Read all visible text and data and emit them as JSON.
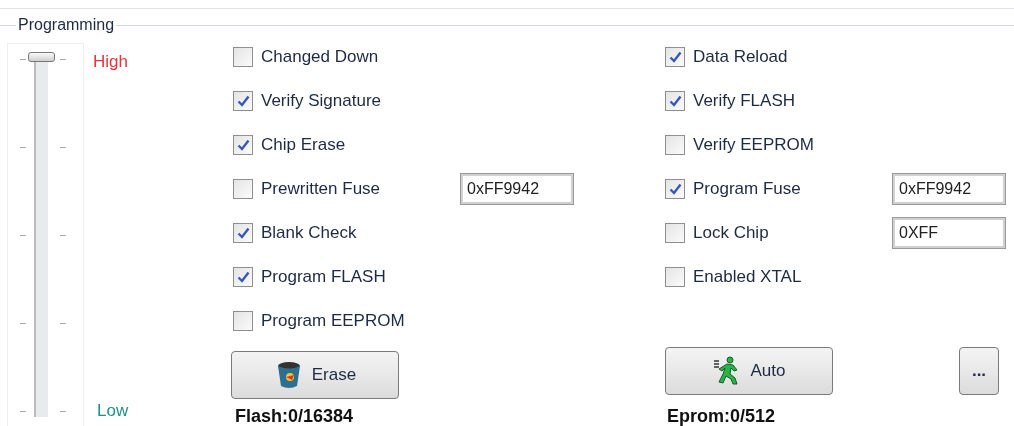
{
  "group": {
    "title": "Programming"
  },
  "slider": {
    "level": 1,
    "high_label": "High",
    "low_label": "Low"
  },
  "left_column": {
    "options": [
      {
        "label": "Changed Down",
        "checked": false
      },
      {
        "label": "Verify Signature",
        "checked": true
      },
      {
        "label": "Chip Erase",
        "checked": true
      },
      {
        "label": "Prewritten Fuse",
        "checked": false,
        "value": "0xFF9942"
      },
      {
        "label": "Blank Check",
        "checked": true
      },
      {
        "label": "Program FLASH",
        "checked": true
      },
      {
        "label": "Program EEPROM",
        "checked": false
      }
    ],
    "button": {
      "kind": "erase",
      "label": "Erase"
    },
    "counter": "Flash:0/16384"
  },
  "right_column": {
    "options": [
      {
        "label": "Data Reload",
        "checked": true
      },
      {
        "label": "Verify FLASH",
        "checked": true
      },
      {
        "label": "Verify EEPROM",
        "checked": false
      },
      {
        "label": "Program Fuse",
        "checked": true,
        "value": "0xFF9942"
      },
      {
        "label": "Lock Chip",
        "checked": false,
        "value": "0XFF"
      },
      {
        "label": "Enabled XTAL",
        "checked": false
      }
    ],
    "button": {
      "kind": "auto",
      "label": "Auto"
    },
    "counter": "Eprom:0/512",
    "extra_button": {
      "label": "..."
    }
  }
}
